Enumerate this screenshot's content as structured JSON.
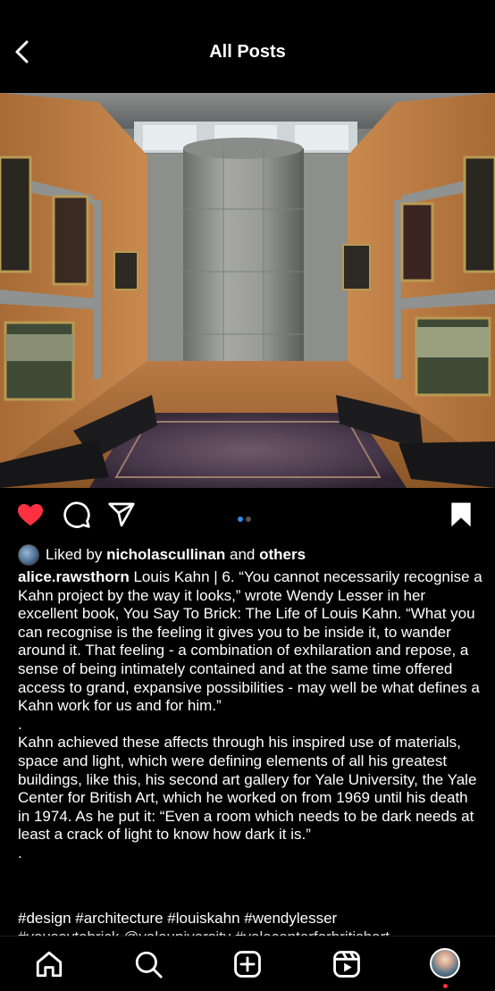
{
  "header": {
    "title": "All Posts"
  },
  "post": {
    "carousel": {
      "count": 2,
      "active": 1
    },
    "likes": {
      "prefix": "Liked by",
      "user": "nicholascullinan",
      "joiner": "and",
      "others": "others"
    },
    "caption": {
      "username": "alice.rawsthorn",
      "paragraph1": "Louis Kahn | 6. “You cannot necessarily recognise a Kahn project by the way it looks,” wrote Wendy Lesser in her excellent book, You Say To Brick: The Life of Louis Kahn. “What you can recognise is the feeling it gives you to be inside it, to wander around it. That feeling - a combination of exhilaration and repose, a sense of being intimately contained and at the same time offered access to grand, expansive possibilities - may well be what defines a Kahn work for us and for him.”",
      "sep1": ".",
      "paragraph2": "Kahn achieved these affects through his inspired use of materials, space and light, which were defining elements of all his greatest buildings, like this, his second art gallery for Yale University, the Yale Center for British Art, which he worked on from 1969 until his death in 1974. As he put it: “Even a room which needs to be dark needs at least a crack of light to know how dark it is.”",
      "sep2": ".",
      "hashtags": "#design #architecture #louiskahn #wendylesser",
      "hashtags_cut": "#yousaytobrick @yaleuniversity #yalecenterforbritishart"
    }
  },
  "colors": {
    "like": "#ff3040",
    "carousel_active": "#2f8de8"
  },
  "icons": [
    "back-arrow-icon",
    "heart-icon",
    "comment-icon",
    "share-icon",
    "bookmark-icon",
    "home-icon",
    "search-icon",
    "new-post-icon",
    "reels-icon"
  ]
}
